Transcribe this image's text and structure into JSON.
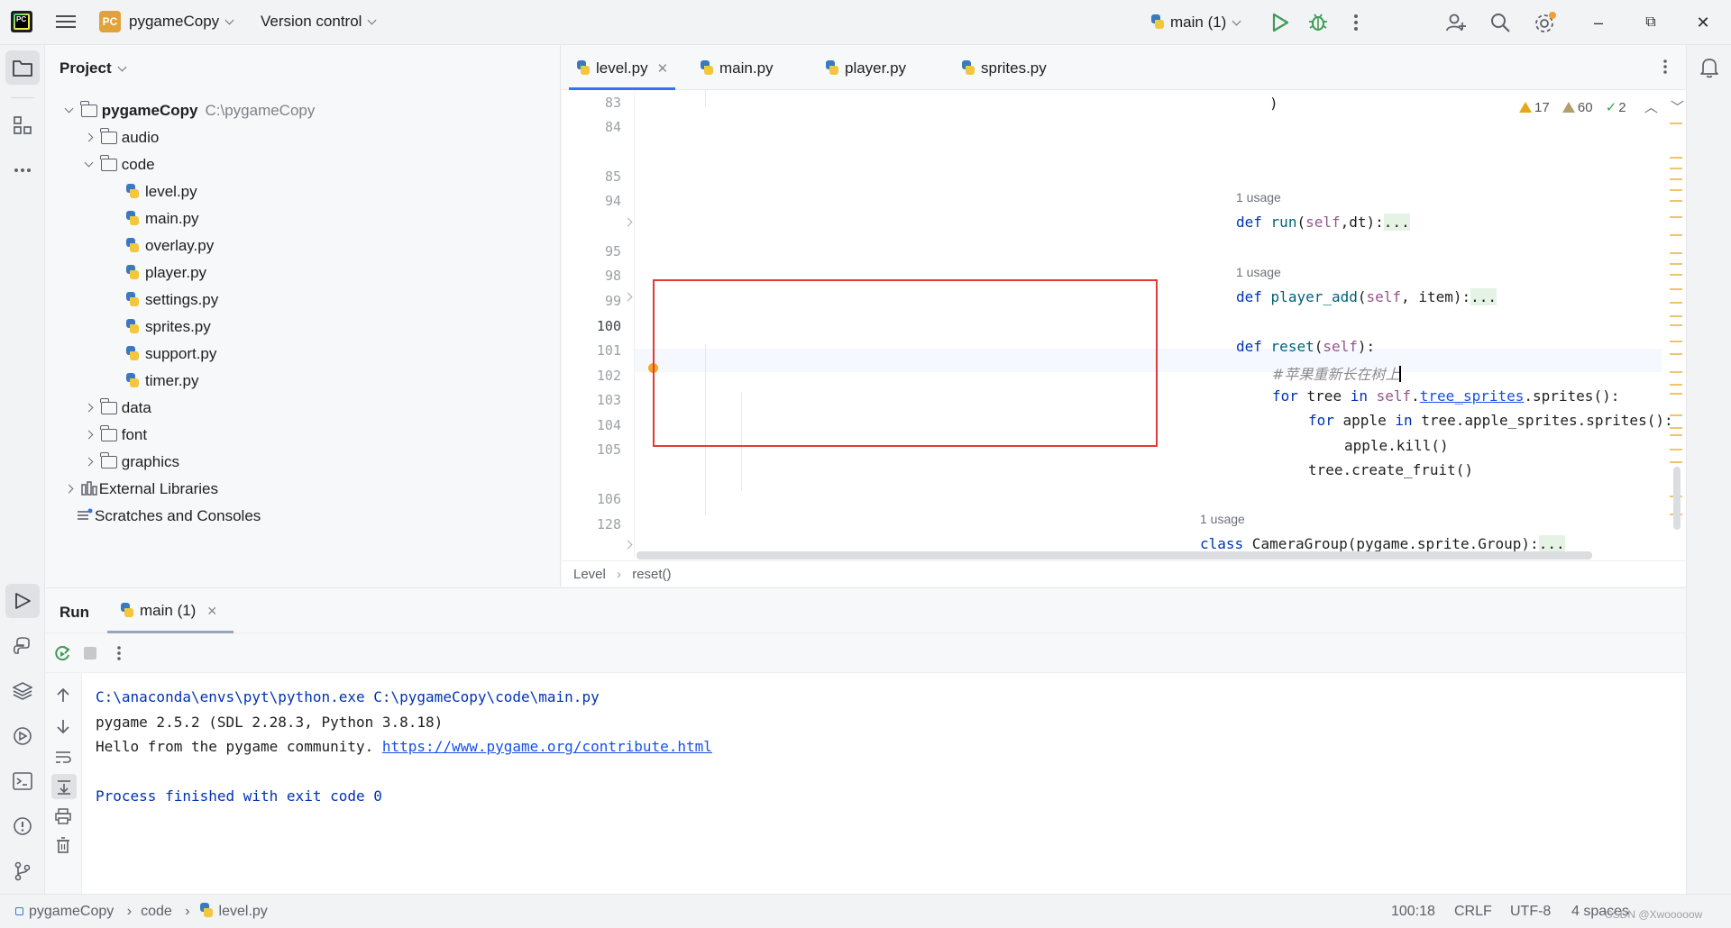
{
  "titlebar": {
    "project_name": "pygameCopy",
    "project_badge": "PC",
    "version_control": "Version control",
    "run_config": "main (1)",
    "window_controls": {
      "minimize": "–",
      "restore": "⧉",
      "close": "✕"
    }
  },
  "project_panel": {
    "title": "Project",
    "root": {
      "label": "pygameCopy",
      "path": "C:\\pygameCopy"
    },
    "items": [
      {
        "label": "audio",
        "type": "folder"
      },
      {
        "label": "code",
        "type": "folder"
      },
      {
        "label": "level.py",
        "type": "python"
      },
      {
        "label": "main.py",
        "type": "python"
      },
      {
        "label": "overlay.py",
        "type": "python"
      },
      {
        "label": "player.py",
        "type": "python"
      },
      {
        "label": "settings.py",
        "type": "python"
      },
      {
        "label": "sprites.py",
        "type": "python"
      },
      {
        "label": "support.py",
        "type": "python"
      },
      {
        "label": "timer.py",
        "type": "python"
      },
      {
        "label": "data",
        "type": "folder"
      },
      {
        "label": "font",
        "type": "folder"
      },
      {
        "label": "graphics",
        "type": "folder"
      },
      {
        "label": "External Libraries",
        "type": "library"
      },
      {
        "label": "Scratches and Consoles",
        "type": "scratches"
      }
    ]
  },
  "editor": {
    "tabs": [
      {
        "label": "level.py",
        "active": true
      },
      {
        "label": "main.py",
        "active": false
      },
      {
        "label": "player.py",
        "active": false
      },
      {
        "label": "sprites.py",
        "active": false
      }
    ],
    "inspection": {
      "warnings": "17",
      "weak_warnings": "60",
      "ok": "2"
    },
    "line_numbers": [
      "83",
      "84",
      "85",
      "94",
      "95",
      "98",
      "99",
      "100",
      "101",
      "102",
      "103",
      "104",
      "105",
      "106",
      "128"
    ],
    "current_line": "100",
    "usages": [
      "1 usage",
      "1 usage",
      "1 usage"
    ],
    "code": {
      "l83": ")",
      "l85_kw": "def",
      "l85_fn": "run",
      "l85_open": "(",
      "l85_self": "self",
      "l85_rest": ",dt):",
      "l85_dots": "...",
      "l95_kw": "def",
      "l95_fn": "player_add",
      "l95_open": "(",
      "l95_self": "self",
      "l95_rest": ", item):",
      "l95_dots": "...",
      "l99_kw": "def",
      "l99_fn": "reset",
      "l99_open": "(",
      "l99_self": "self",
      "l99_rest": "):",
      "l100_comment": "#苹果重新长在树上",
      "l101_kw1": "for",
      "l101_a": " tree ",
      "l101_kw2": "in",
      "l101_self": " self",
      "l101_dot": ".",
      "l101_ref": "tree_sprites",
      "l101_rest": ".sprites():",
      "l102_kw1": "for",
      "l102_a": " apple ",
      "l102_kw2": "in",
      "l102_rest": " tree.apple_sprites.sprites():",
      "l103": "apple.kill()",
      "l104": "tree.create_fruit()",
      "l106_kw": "class",
      "l106_rest": " CameraGroup(pygame.sprite.Group):",
      "l106_dots": "..."
    },
    "breadcrumb": [
      "Level",
      "reset()"
    ]
  },
  "run_panel": {
    "title": "Run",
    "tab_label": "main (1)",
    "console": {
      "line1": "C:\\anaconda\\envs\\pyt\\python.exe C:\\pygameCopy\\code\\main.py",
      "line2": "pygame 2.5.2 (SDL 2.28.3, Python 3.8.18)",
      "line3_text": "Hello from the pygame community. ",
      "line3_link": "https://www.pygame.org/contribute.html",
      "line5": "Process finished with exit code 0"
    }
  },
  "statusbar": {
    "breadcrumb": [
      "pygameCopy",
      "code",
      "level.py"
    ],
    "position": "100:18",
    "line_ending": "CRLF",
    "encoding": "UTF-8",
    "indent": "4 spaces",
    "watermark": "CSDN @Xwooooow"
  },
  "colors": {
    "accent": "#3574f0",
    "highlight_box": "#e53935",
    "keyword": "#0033b3",
    "function": "#00627a",
    "self": "#94558d"
  }
}
